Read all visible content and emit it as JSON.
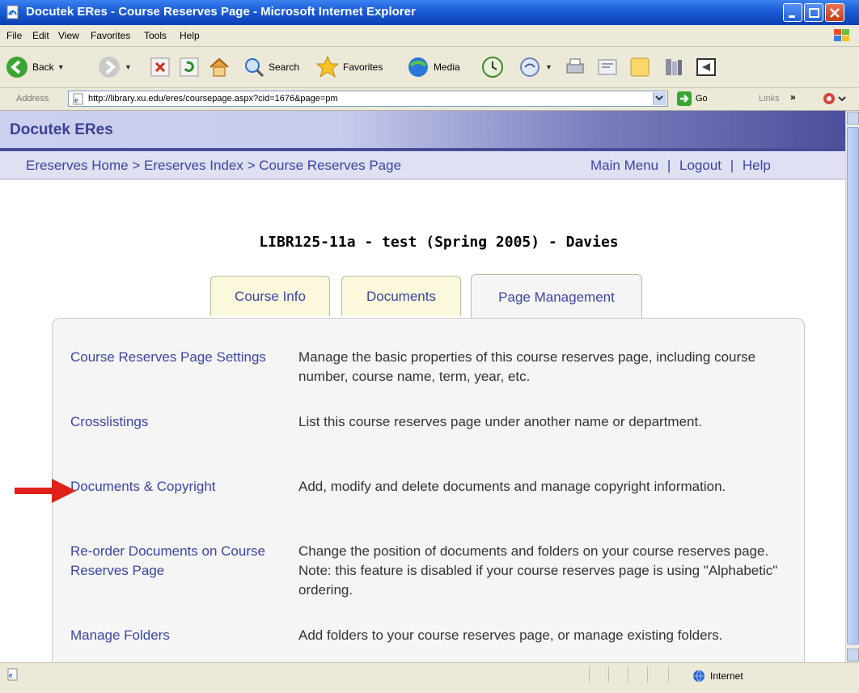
{
  "window": {
    "title": "Docutek ERes - Course Reserves Page - Microsoft Internet Explorer"
  },
  "menubar": {
    "items": [
      "File",
      "Edit",
      "View",
      "Favorites",
      "Tools",
      "Help"
    ]
  },
  "toolbar": {
    "back_label": "Back",
    "search_label": "Search",
    "favorites_label": "Favorites",
    "media_label": "Media"
  },
  "addressbar": {
    "label": "Address",
    "url": "http://library.xu.edu/eres/coursepage.aspx?cid=1676&page=pm",
    "go_label": "Go",
    "links_label": "Links",
    "links_arrow": "»"
  },
  "site": {
    "brand": "Docutek ERes",
    "breadcrumb": {
      "home": "Ereserves Home",
      "index": "Ereserves Index",
      "current": "Course Reserves Page",
      "sep": ">"
    },
    "nav": {
      "main_menu": "Main Menu",
      "logout": "Logout",
      "help": "Help",
      "sep": "|"
    }
  },
  "course": {
    "code": "LIBR125-11a - test (Spring 2005) - Davies"
  },
  "tabs": [
    {
      "label": "Course Info",
      "active": false
    },
    {
      "label": "Documents",
      "active": false
    },
    {
      "label": "Page Management",
      "active": true
    }
  ],
  "items": [
    {
      "link": "Course Reserves Page Settings",
      "desc": "Manage the basic properties of this course reserves page, including course number, course name, term, year, etc."
    },
    {
      "link": "Crosslistings",
      "desc": "List this course reserves page under another name or department."
    },
    {
      "link": "Documents & Copyright",
      "desc": "Add, modify and delete documents and manage copyright information."
    },
    {
      "link": "Re-order Documents on Course Reserves Page",
      "desc": "Change the position of documents and folders on your course reserves page. Note: this feature is disabled if your course reserves page is using \"Alphabetic\" ordering."
    },
    {
      "link": "Manage Folders",
      "desc": "Add folders to your course reserves page, or manage existing folders."
    }
  ],
  "statusbar": {
    "zone": "Internet"
  },
  "colors": {
    "link": "#3b45a0",
    "banner_dark": "#4a4d99",
    "arrow": "#e0201a"
  }
}
